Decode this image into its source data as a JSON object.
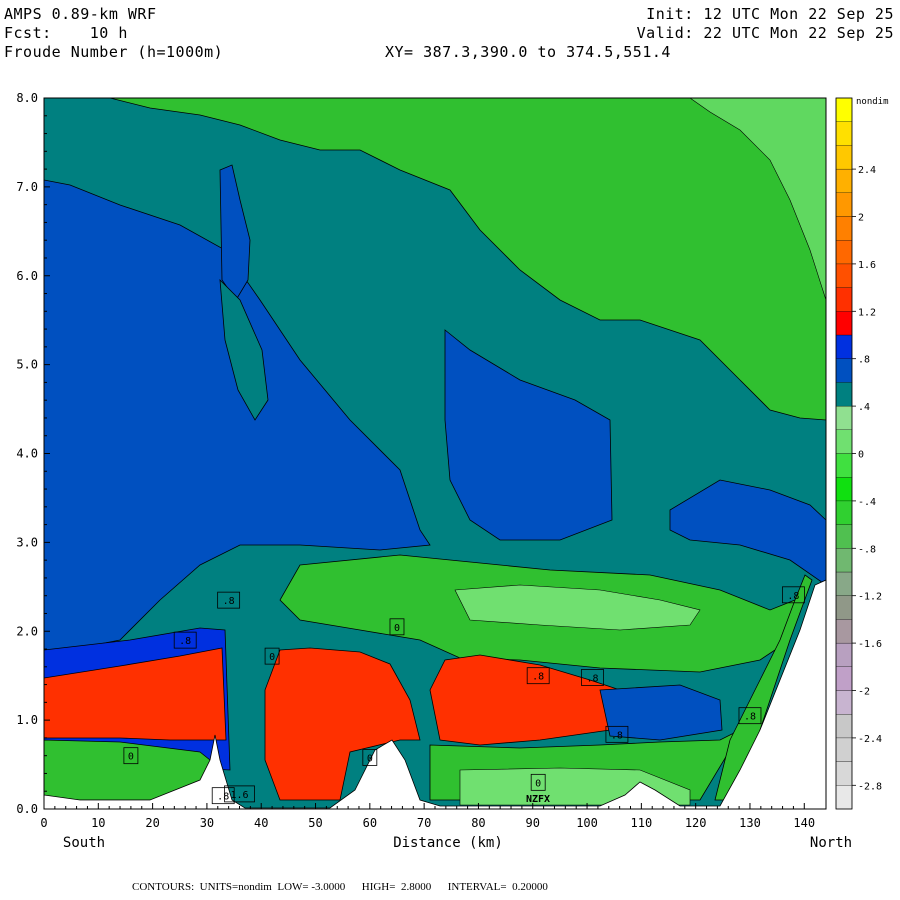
{
  "header": {
    "model": "AMPS 0.89-km WRF",
    "fcst": "Fcst:    10 h",
    "field": "Froude Number (h=1000m)",
    "init": "Init: 12 UTC Mon 22 Sep 25",
    "valid": "Valid: 22 UTC Mon 22 Sep 25",
    "xy": "XY= 387.3,390.0 to 374.5,551.4"
  },
  "footer": {
    "contours": "CONTOURS:  UNITS=nondim  LOW= -3.0000      HIGH=  2.8000      INTERVAL=  0.20000"
  },
  "chart_data": {
    "type": "contour-cross-section",
    "xlabel": "Distance (km)",
    "x_left_label": "South",
    "x_right_label": "North",
    "xlim": [
      0,
      144
    ],
    "ylim": [
      0,
      8
    ],
    "x_ticks": [
      0,
      10,
      20,
      30,
      40,
      50,
      60,
      70,
      80,
      90,
      100,
      110,
      120,
      130,
      140
    ],
    "y_ticks": [
      "0.0",
      "1.0",
      "2.0",
      "3.0",
      "4.0",
      "5.0",
      "6.0",
      "7.0",
      "8.0"
    ],
    "colorbar": {
      "unit": "nondim",
      "labels": [
        "2.4",
        "2",
        "1.6",
        "1.2",
        ".8",
        ".4",
        "0",
        "-.4",
        "-.8",
        "-1.2",
        "-1.6",
        "-2",
        "-2.4",
        "-2.8"
      ],
      "colors": [
        "#e8e8e8",
        "#d8d8d8",
        "#d0d0d0",
        "#c8c8c8",
        "#c8b4d0",
        "#c0a0c8",
        "#b8a0c0",
        "#a898a0",
        "#909888",
        "#88a888",
        "#70b870",
        "#50c050",
        "#30d030",
        "#10e010",
        "#40e040",
        "#70e070",
        "#90e090",
        "#008080",
        "#0050c0",
        "#0030e0",
        "#ff0000",
        "#ff3000",
        "#ff5000",
        "#ff6800",
        "#ff8000",
        "#ff9800",
        "#ffb000",
        "#ffc800",
        "#ffe000",
        "#ffff00"
      ]
    },
    "contour_labels": [
      ".8",
      ".8",
      "0",
      "0",
      ".8",
      "0",
      ".8",
      ".8",
      ".8",
      ".8",
      "0",
      ".8",
      "0",
      "1.6"
    ],
    "annotation": "NZFX"
  }
}
